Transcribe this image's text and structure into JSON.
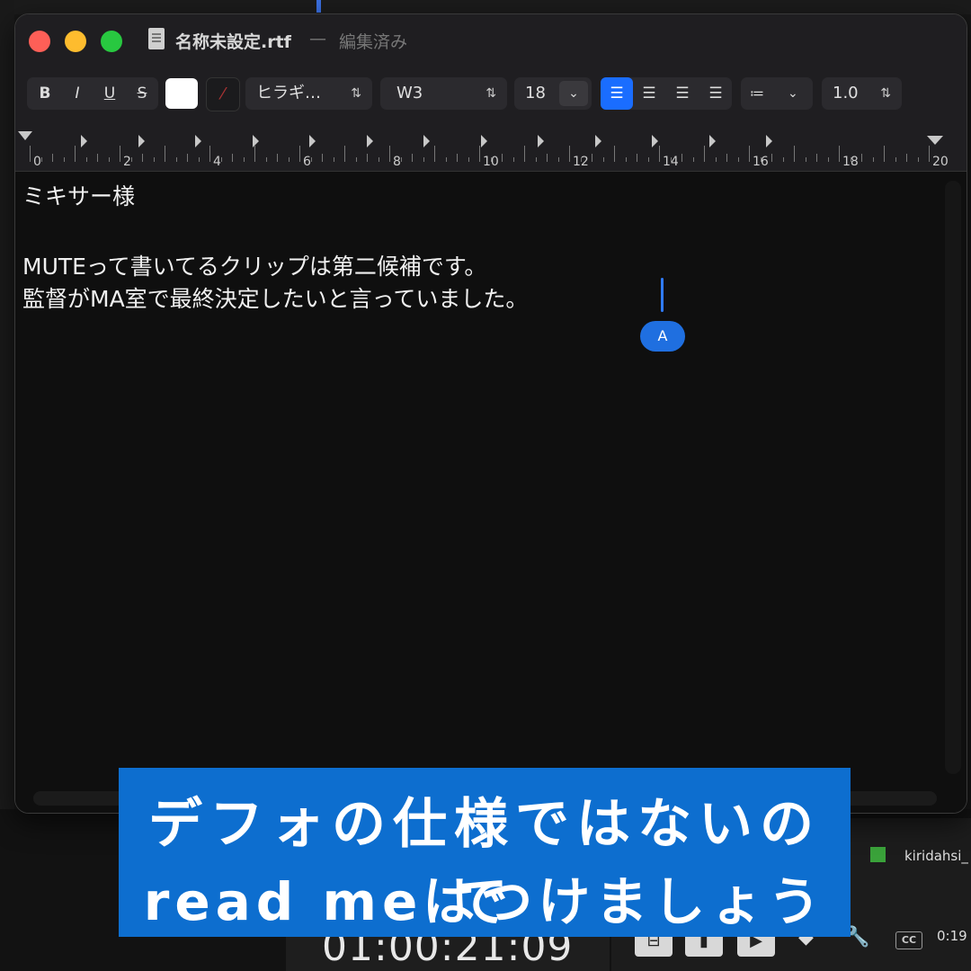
{
  "window": {
    "title": "名称未設定.rtf",
    "separator": "—",
    "status": "編集済み"
  },
  "toolbar": {
    "bold": "B",
    "italic": "I",
    "underline": "U",
    "strikethrough": "S",
    "text_color": "#ffffff",
    "highlight_icon": "no-highlight-icon",
    "font_family": "ヒラギ…",
    "font_weight": "W3",
    "font_size": "18",
    "alignment_selected": "left",
    "list_icon": "list-icon",
    "line_spacing": "1.0"
  },
  "ruler": {
    "labels": [
      "0",
      "2",
      "4",
      "6",
      "8",
      "10",
      "12",
      "14",
      "16",
      "18",
      "20"
    ]
  },
  "document": {
    "lines": [
      "ミキサー様",
      "",
      "MUTEって書いてるクリップは第二候補です。",
      "監督がMA室で最終決定したいと言っていました。"
    ],
    "input_mode_badge": "A"
  },
  "background_app": {
    "timecode": "01:00:21:09",
    "clip_name": "kiridahsi_",
    "clip_color": "#3aa23a",
    "cc_label": "CC",
    "small_timecode": "0:19"
  },
  "caption": {
    "line1": "デフォの仕様ではないので",
    "line2": "read meはつけましょう",
    "background": "#0d6ecf"
  }
}
